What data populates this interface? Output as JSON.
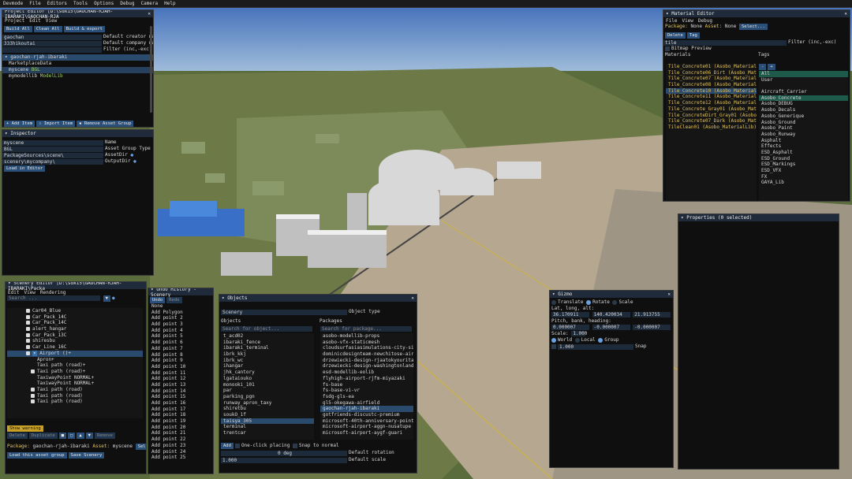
{
  "menubar": [
    "Devmode",
    "File",
    "Editors",
    "Tools",
    "Options",
    "Debug",
    "Camera",
    "Help"
  ],
  "project_editor": {
    "title": "Project Editor [D:\\sdk15\\GAOCHAN-RJAH-IBARAKI\\GAOCHAN-RJA",
    "menu": [
      "Project",
      "Edit",
      "View"
    ],
    "buttons": [
      "Build All",
      "Clean All",
      "Build & export"
    ],
    "creator_value": "gaochan",
    "creator_label": "Default creator name",
    "company_value": "333hikoutai",
    "company_label": "Default company name",
    "filter_label": "Filter (inc,-exc)",
    "tree_root": "gaochan-rjah-ibaraki",
    "tree_items": [
      "MarketplaceData",
      "myscene",
      "mymodellib"
    ],
    "myscene_tag": "BGL",
    "mymodellib_tag": "ModelLib",
    "bottom_buttons": [
      "Add Item",
      "Import Item",
      "Remove Asset Group"
    ]
  },
  "inspector": {
    "title": "Inspector",
    "name_value": "myscene",
    "name_label": "Name",
    "type_value": "BGL",
    "type_label": "Asset Group Type",
    "assetdir_value": "PackageSources\\scene\\",
    "assetdir_label": "AssetDir",
    "outputdir_value": "scenery\\mycompany\\",
    "outputdir_label": "OutputDir",
    "load_button": "Load in Editor"
  },
  "material_editor": {
    "title": "Material Editor",
    "menu": [
      "File",
      "View",
      "Debug"
    ],
    "package_label": "Package:",
    "package_value": "None",
    "asset_label": "Asset:",
    "asset_value": "None",
    "select_button": "Select...",
    "buttons": [
      "Delete",
      "Tag"
    ],
    "search_value": "tile",
    "filter_label": "Filter (inc,-exc)",
    "bitmap_preview": "Bitmap Preview",
    "materials_header": "Materials",
    "tags_header": "Tags",
    "materials": [
      "Tile_Concrete01 (Asobo_MaterialLib)",
      "Tile_Concrete06_Dirt (Asobo_Material",
      "Tile_Concrete07 (Asobo_MaterialLib)",
      "Tile_Concrete08 (Asobo_MaterialLib)",
      "Tile_Concrete10 (Asobo_MaterialLib)",
      "Tile_Concrete11 (Asobo_MaterialLib)",
      "Tile_Concrete12 (Asobo_MaterialLib)",
      "Tile_Concrete_Gray01 (Asobo_Materia",
      "Tile_ConcreteDirt_Gray01 (Asobo_Mat",
      "Tile_Concrete07_Dark (Asobo_Materia",
      "TileClean01 (Asobo_MaterialLib)"
    ],
    "tags": [
      "All",
      "User",
      "",
      "Aircraft_Carrier",
      "Asobo_Concrete",
      "Asobo_DEBUG",
      "Asobo_Decals",
      "Asobo_Generique",
      "Asobo_Ground",
      "Asobo_Paint",
      "Asobo_Runway",
      "Asphalt",
      "Effects",
      "ESD_Asphalt",
      "ESD_Ground",
      "ESD_Markings",
      "ESD_VFX",
      "FX",
      "GAYA_Lib"
    ]
  },
  "properties": {
    "title": "Properties (0 selected)"
  },
  "scenery_editor": {
    "title": "Scenery Editor [D:\\sdk15\\GAOCHAN-RJAH-IBARAKI\\Packa",
    "menu": [
      "Edit",
      "View",
      "Rendering"
    ],
    "search_placeholder": "Search ...",
    "items": [
      "Car04_Blue",
      "Car_Pack_14C",
      "Car_Pack_14C",
      "alert_hangar",
      "Car_Pack_13C",
      "shiresbu",
      "Car_Line_16C",
      "Airport  ()+",
      "Apron+",
      "Taxi path  (road)+",
      "Taxi path  (road)+",
      "TaxiwayPoint NORMAL+",
      "TaxiwayPoint NORMAL+",
      "Taxi path  (road)",
      "Taxi path  (road)",
      "Taxi path  (road)"
    ],
    "warning_button": "Show warning",
    "action_buttons": [
      "Delete",
      "Duplicate",
      "Remove"
    ],
    "package_label": "Package:",
    "package_value": "gaochan-rjah-ibaraki",
    "asset_label": "Asset:",
    "asset_value": "myscene",
    "select_button": "Select...",
    "bottom_buttons": [
      "Load this asset group",
      "Save Scenery"
    ]
  },
  "undo_history": {
    "title": "Undo History - Scenery",
    "buttons": [
      "Undo",
      "Redo"
    ],
    "items": [
      "None",
      "Add Polygon",
      "Add point 2",
      "Add point 3",
      "Add point 4",
      "Add point 5",
      "Add point 6",
      "Add point 7",
      "Add point 8",
      "Add point 9",
      "Add point 10",
      "Add point 11",
      "Add point 12",
      "Add point 13",
      "Add point 14",
      "Add point 15",
      "Add point 16",
      "Add point 17",
      "Add point 18",
      "Add point 19",
      "Add point 20",
      "Add point 21",
      "Add point 22",
      "Add point 23",
      "Add point 24",
      "Add point 25"
    ]
  },
  "objects": {
    "title": "Objects",
    "type_value": "Scenery",
    "type_label": "Object type",
    "objects_header": "Objects",
    "packages_header": "Packages",
    "object_search_placeholder": "Search for object...",
    "package_search_placeholder": "Search for package...",
    "objects": [
      "t_acd02",
      "ibaraki_fence",
      "ibaraki_terminal",
      "ibrk_kkj",
      "ibrk_wc",
      "ihangar",
      "jhk_cantory",
      "lgataiouko",
      "monooki_101",
      "par",
      "parking_pgn",
      "runway_apron_taxy",
      "shiretbu",
      "soukO_1f",
      "taisya_305",
      "terminal",
      "trentcar"
    ],
    "packages": [
      "asobo-modellib-props",
      "asobo-vfx-staticmesh",
      "cloudsurfasiasimulations-city-singapo",
      "dominicdesignteam-newchitose-airport",
      "drzewiecki-design-rjaatokyourita",
      "drzewiecki-design-washingtonlandmarks",
      "esd-modellib-eolib",
      "flyhigh-airport-rjfm-miyazaki",
      "fs-base",
      "fs-base-vi-vr",
      "fsdg-gls-ea",
      "gl5-okegawa-airfield",
      "gaochan-rjah-ibaraki",
      "gotfriends-discustc-premium",
      "microsoft-40th-anniversary-point-of-i",
      "microsoft-airport-aggn-nusatupe",
      "microsoft-airport-aygf-guari"
    ],
    "add_button": "Add",
    "one_click": "One-click placing",
    "snap_normal": "Snap to normal",
    "rotation_value": "0 deg",
    "rotation_label": "Default rotation",
    "scale_value": "1.000",
    "scale_label": "Default scale"
  },
  "gizmo": {
    "title": "Gizmo",
    "modes": [
      "Translate",
      "Rotate",
      "Scale"
    ],
    "latlon_label": "Lat, long, alt:",
    "latlon_values": [
      "36.170911",
      "140.420034",
      "21.913755"
    ],
    "pbh_label": "Pitch, bank, heading:",
    "pbh_values": [
      "0.000007",
      "-0.000007",
      "-0.000007"
    ],
    "scale_label": "Scale:",
    "scale_value": "1.000",
    "spaces": [
      "World",
      "Local",
      "Group"
    ],
    "snap_value": "1.000",
    "snap_label": "Snap"
  },
  "colors": {
    "title_bar": "#1f2b3a",
    "button": "#2a4f78",
    "selection": "#2a4a6e",
    "material_text": "#e3c35a"
  }
}
